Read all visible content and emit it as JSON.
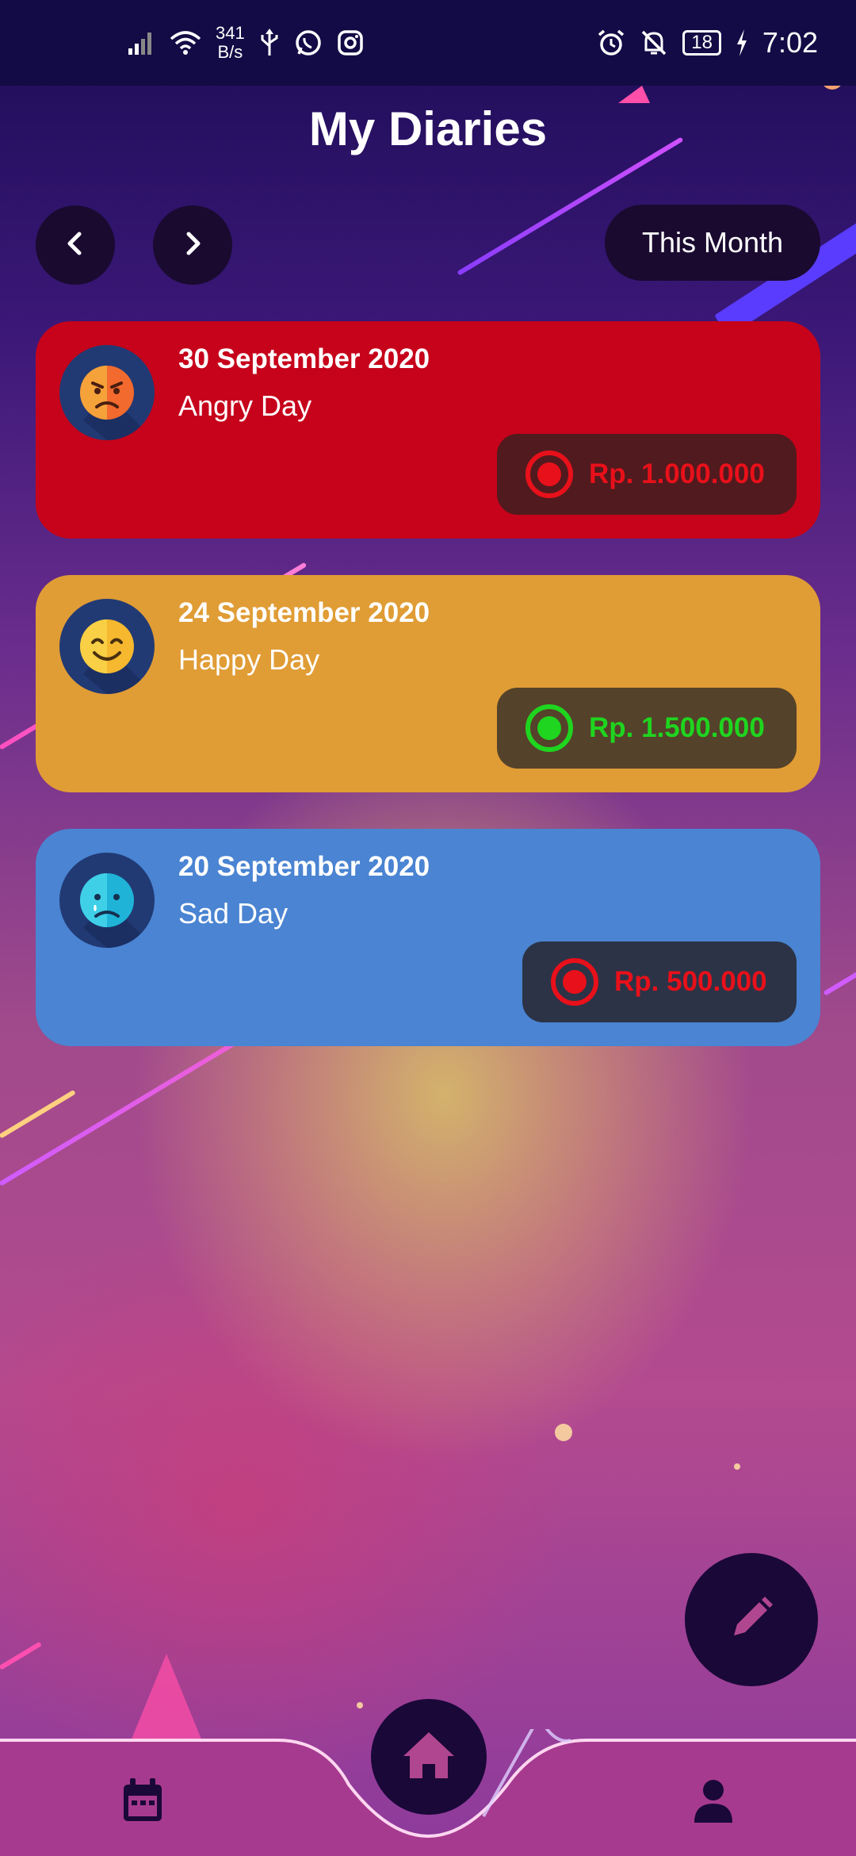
{
  "status_bar": {
    "net_speed_value": "341",
    "net_speed_unit": "B/s",
    "battery": "18",
    "time": "7:02",
    "icons": [
      "signal-icon",
      "wifi-icon",
      "usb-icon",
      "whatsapp-icon",
      "instagram-icon",
      "alarm-icon",
      "mute-icon",
      "battery-icon",
      "charging-icon"
    ]
  },
  "header": {
    "title": "My Diaries",
    "prev_icon": "chevron-left-icon",
    "next_icon": "chevron-right-icon",
    "period_label": "This Month"
  },
  "entries": [
    {
      "date": "30 September 2020",
      "mood": "Angry Day",
      "amount": "Rp. 1.000.000",
      "amount_color": "#e8101a",
      "card_color": "#c6031b",
      "icon": "angry-face-icon"
    },
    {
      "date": "24 September 2020",
      "mood": "Happy Day",
      "amount": "Rp. 1.500.000",
      "amount_color": "#1fd51f",
      "card_color": "#e09c35",
      "icon": "happy-face-icon"
    },
    {
      "date": "20 September 2020",
      "mood": "Sad Day",
      "amount": "Rp. 500.000",
      "amount_color": "#e8101a",
      "card_color": "#4a84d2",
      "icon": "sad-face-icon"
    }
  ],
  "fab": {
    "icon": "pencil-icon"
  },
  "bottom_nav": {
    "items": [
      {
        "icon": "calendar-icon"
      },
      {
        "icon": "home-icon"
      },
      {
        "icon": "person-icon"
      }
    ],
    "bar_color": "#a63a8e"
  }
}
